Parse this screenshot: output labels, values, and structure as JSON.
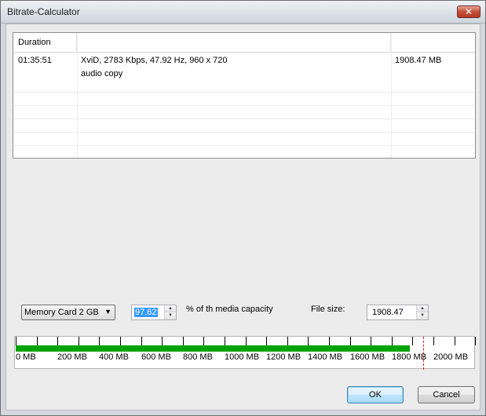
{
  "window": {
    "title": "Bitrate-Calculator",
    "close_glyph": "✕"
  },
  "list": {
    "columns": [
      "Duration",
      "",
      ""
    ],
    "rows": [
      {
        "duration": "01:35:51",
        "info": "XviD, 2783 Kbps, 47.92 Hz, 960 x 720",
        "size": "1908.47 MB"
      },
      {
        "duration": "",
        "info": "audio copy",
        "size": ""
      }
    ]
  },
  "controls": {
    "media_select": {
      "value": "Memory Card 2 GB",
      "arrow_icon": "chevron-down-icon"
    },
    "percent_value": "97.62",
    "percent_label": "% of th media capacity",
    "filesize_label": "File size:",
    "filesize_value": "1908.47"
  },
  "capacity_bar": {
    "fill_fraction": 0.9542,
    "fill_color": "#06a306",
    "limit_mb": 1952.4,
    "max_mb": 2200,
    "tick_labels": [
      "0 MB",
      "200 MB",
      "400 MB",
      "600 MB",
      "800 MB",
      "1000 MB",
      "1200 MB",
      "1400 MB",
      "1600 MB",
      "1800 MB",
      "2000 MB"
    ]
  },
  "buttons": {
    "ok": "OK",
    "cancel": "Cancel"
  }
}
